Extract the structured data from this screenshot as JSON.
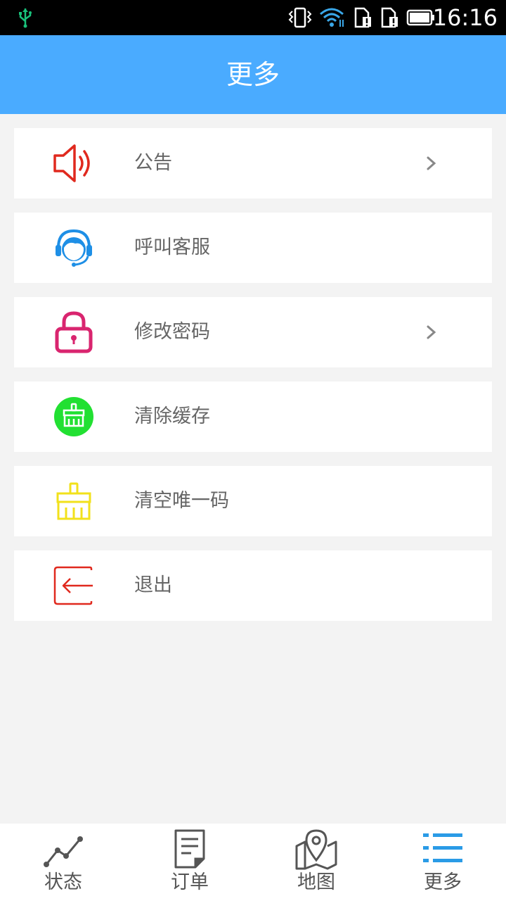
{
  "status_bar": {
    "time": "16:16"
  },
  "header": {
    "title": "更多"
  },
  "menu": {
    "items": [
      {
        "label": "公告",
        "icon": "speaker-icon",
        "has_chevron": true
      },
      {
        "label": "呼叫客服",
        "icon": "customer-service-icon",
        "has_chevron": false
      },
      {
        "label": "修改密码",
        "icon": "lock-icon",
        "has_chevron": true
      },
      {
        "label": "清除缓存",
        "icon": "broom-icon",
        "has_chevron": false
      },
      {
        "label": "清空唯一码",
        "icon": "broom-outline-icon",
        "has_chevron": false
      },
      {
        "label": "退出",
        "icon": "logout-icon",
        "has_chevron": false
      }
    ]
  },
  "tabbar": {
    "tabs": [
      {
        "label": "状态",
        "icon": "trend-chart-icon",
        "active": false
      },
      {
        "label": "订单",
        "icon": "document-icon",
        "active": false
      },
      {
        "label": "地图",
        "icon": "map-pin-icon",
        "active": false
      },
      {
        "label": "更多",
        "icon": "list-icon",
        "active": true
      }
    ]
  },
  "colors": {
    "header": "#4aabff",
    "speaker": "#e0291e",
    "service": "#1e8fe6",
    "lock": "#d9256f",
    "broom_fill": "#22e032",
    "broom_outline": "#f2e11b",
    "logout": "#e0291e",
    "tab_active": "#2a9be6",
    "tab_inactive": "#555555"
  }
}
